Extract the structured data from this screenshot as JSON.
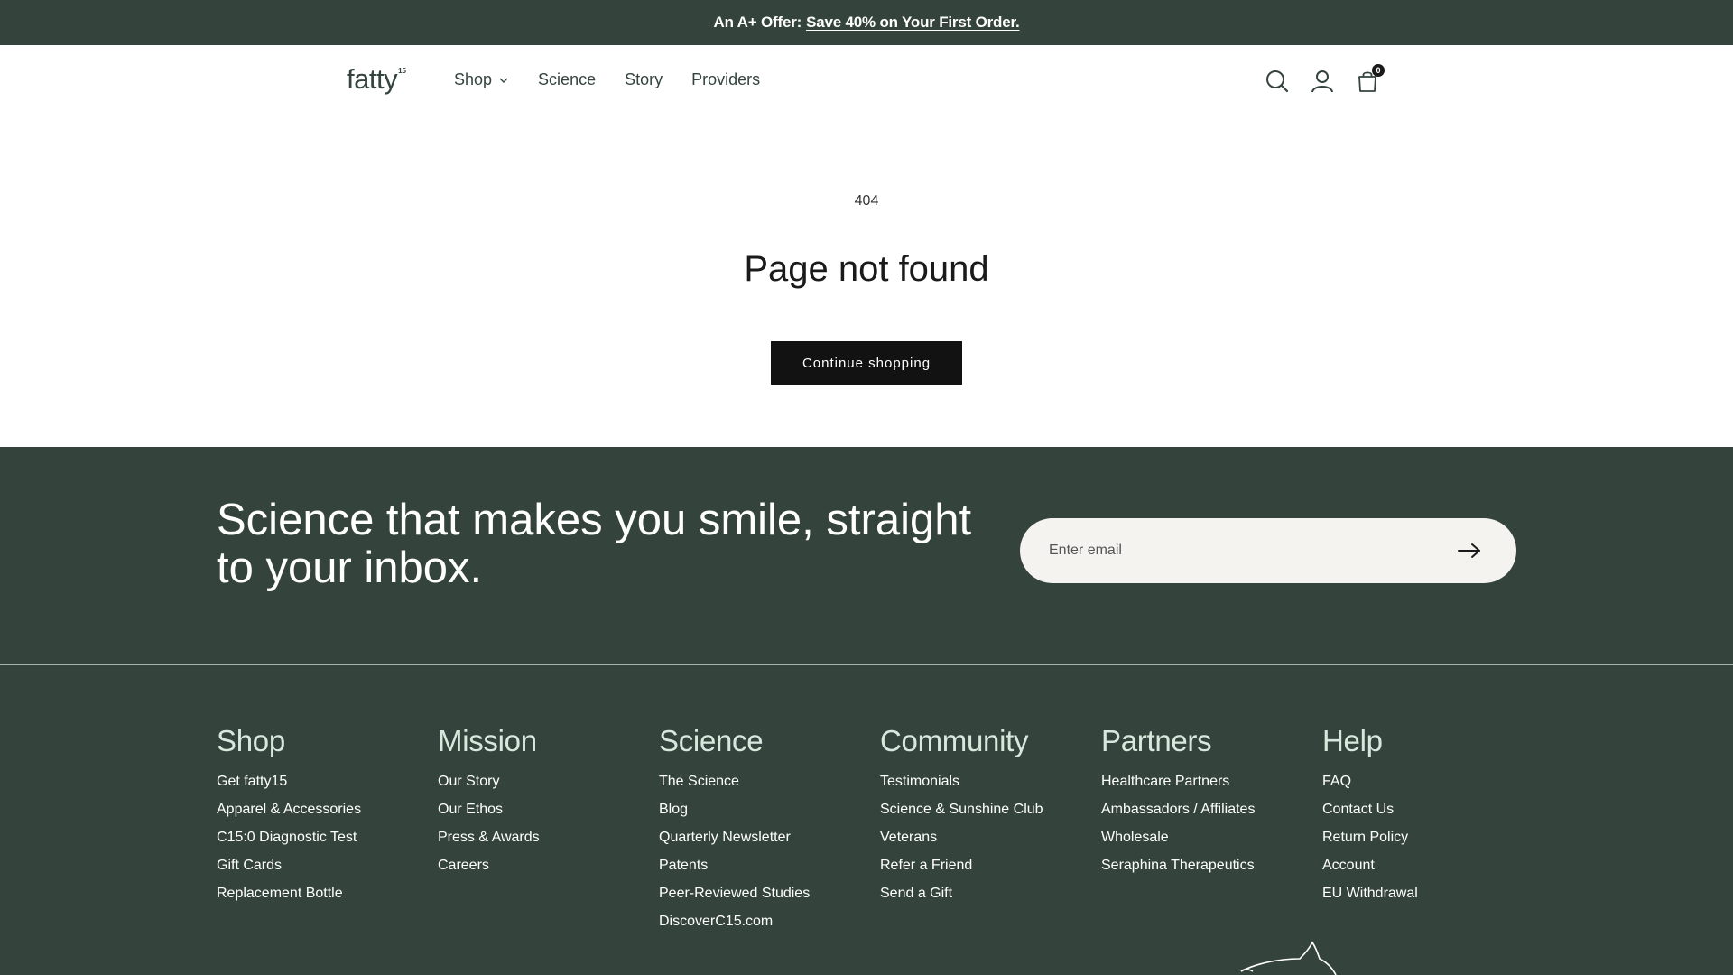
{
  "announcement": {
    "lead": "An A+ Offer:",
    "link": "Save 40% on Your First Order."
  },
  "header": {
    "logo_text": "fatty",
    "logo_sup": "15",
    "nav": [
      {
        "label": "Shop",
        "has_dropdown": true
      },
      {
        "label": "Science"
      },
      {
        "label": "Story"
      },
      {
        "label": "Providers"
      }
    ],
    "icons": [
      "search-icon",
      "account-icon",
      "cart-icon"
    ],
    "cart_count": "0"
  },
  "main": {
    "code": "404",
    "title": "Page not found",
    "cta": "Continue shopping"
  },
  "newsletter": {
    "heading": "Science that makes you smile, straight to your inbox.",
    "placeholder": "Enter email",
    "submit_icon": "arrow-right-icon"
  },
  "footer": {
    "columns": [
      {
        "title": "Shop",
        "links": [
          "Get fatty15",
          "Apparel & Accessories",
          "C15:0 Diagnostic Test",
          "Gift Cards",
          "Replacement Bottle"
        ]
      },
      {
        "title": "Mission",
        "links": [
          "Our Story",
          "Our Ethos",
          "Press & Awards",
          "Careers"
        ]
      },
      {
        "title": "Science",
        "links": [
          "The Science",
          "Blog",
          "Quarterly Newsletter",
          "Patents",
          "Peer-Reviewed Studies",
          "DiscoverC15.com"
        ]
      },
      {
        "title": "Community",
        "links": [
          "Testimonials",
          "Science & Sunshine Club",
          "Veterans",
          "Refer a Friend",
          "Send a Gift"
        ]
      },
      {
        "title": "Partners",
        "links": [
          "Healthcare Partners",
          "Ambassadors / Affiliates",
          "Wholesale",
          "Seraphina Therapeutics"
        ]
      },
      {
        "title": "Help",
        "links": [
          "FAQ",
          "Contact Us",
          "Return Policy",
          "Account",
          "EU Withdrawal"
        ]
      }
    ]
  },
  "colors": {
    "brand_dark": "#34443d",
    "heading_mint": "#d8e8dc",
    "input_bg": "#f4f3ef",
    "button": "#121212"
  }
}
